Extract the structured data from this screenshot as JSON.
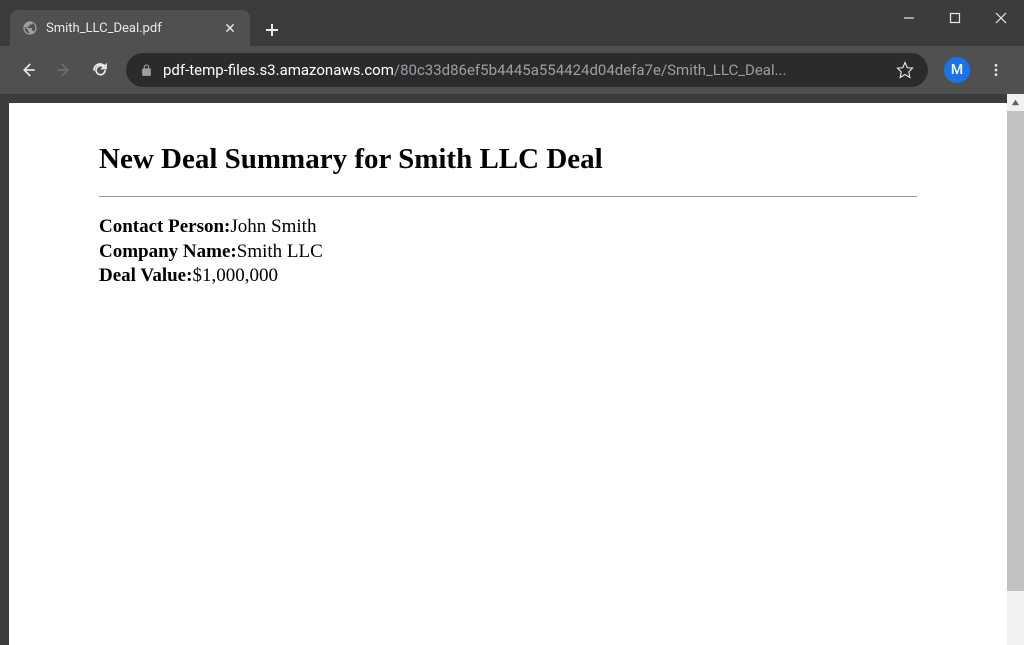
{
  "browser": {
    "tab": {
      "title": "Smith_LLC_Deal.pdf"
    },
    "url": {
      "domain": "pdf-temp-files.s3.amazonaws.com",
      "path": "/80c33d86ef5b4445a554424d04defa7e/Smith_LLC_Deal..."
    },
    "avatar_letter": "M"
  },
  "document": {
    "title": "New Deal Summary for Smith LLC Deal",
    "fields": {
      "contact_person": {
        "label": "Contact Person:",
        "value": "John Smith"
      },
      "company_name": {
        "label": "Company Name:",
        "value": "Smith LLC"
      },
      "deal_value": {
        "label": "Deal Value:",
        "value": "$1,000,000"
      }
    }
  }
}
